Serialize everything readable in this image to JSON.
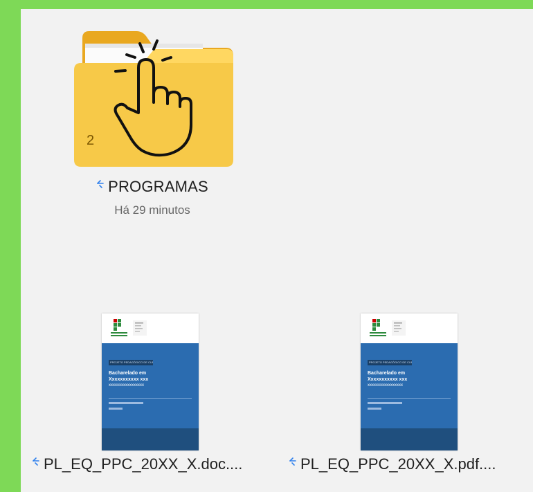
{
  "folder": {
    "name": "PROGRAMAS",
    "modified": "Há 29 minutos",
    "item_count": "2",
    "icon": "folder-icon",
    "cursor_icon": "hand-pointer-icon"
  },
  "files": [
    {
      "name": "PL_EQ_PPC_20XX_X.doc....",
      "icon": "document-thumbnail",
      "thumb_tag": "PROJETO PEDAGÓGICO DE CURSO",
      "thumb_title_1": "Bacharelado em",
      "thumb_title_2": "Xxxxxxxxxxx xxx",
      "thumb_title_3": "xxxxxxxxxxxxxxxxx"
    },
    {
      "name": "PL_EQ_PPC_20XX_X.pdf....",
      "icon": "document-thumbnail",
      "thumb_tag": "PROJETO PEDAGÓGICO DE CURSO",
      "thumb_title_1": "Bacharelado em",
      "thumb_title_2": "Xxxxxxxxxxx xxx",
      "thumb_title_3": "xxxxxxxxxxxxxxxxx"
    }
  ],
  "colors": {
    "frame": "#7ed957",
    "folder": "#f7c948",
    "sync": "#2f80ed",
    "doc_blue": "#2b6cb0"
  }
}
